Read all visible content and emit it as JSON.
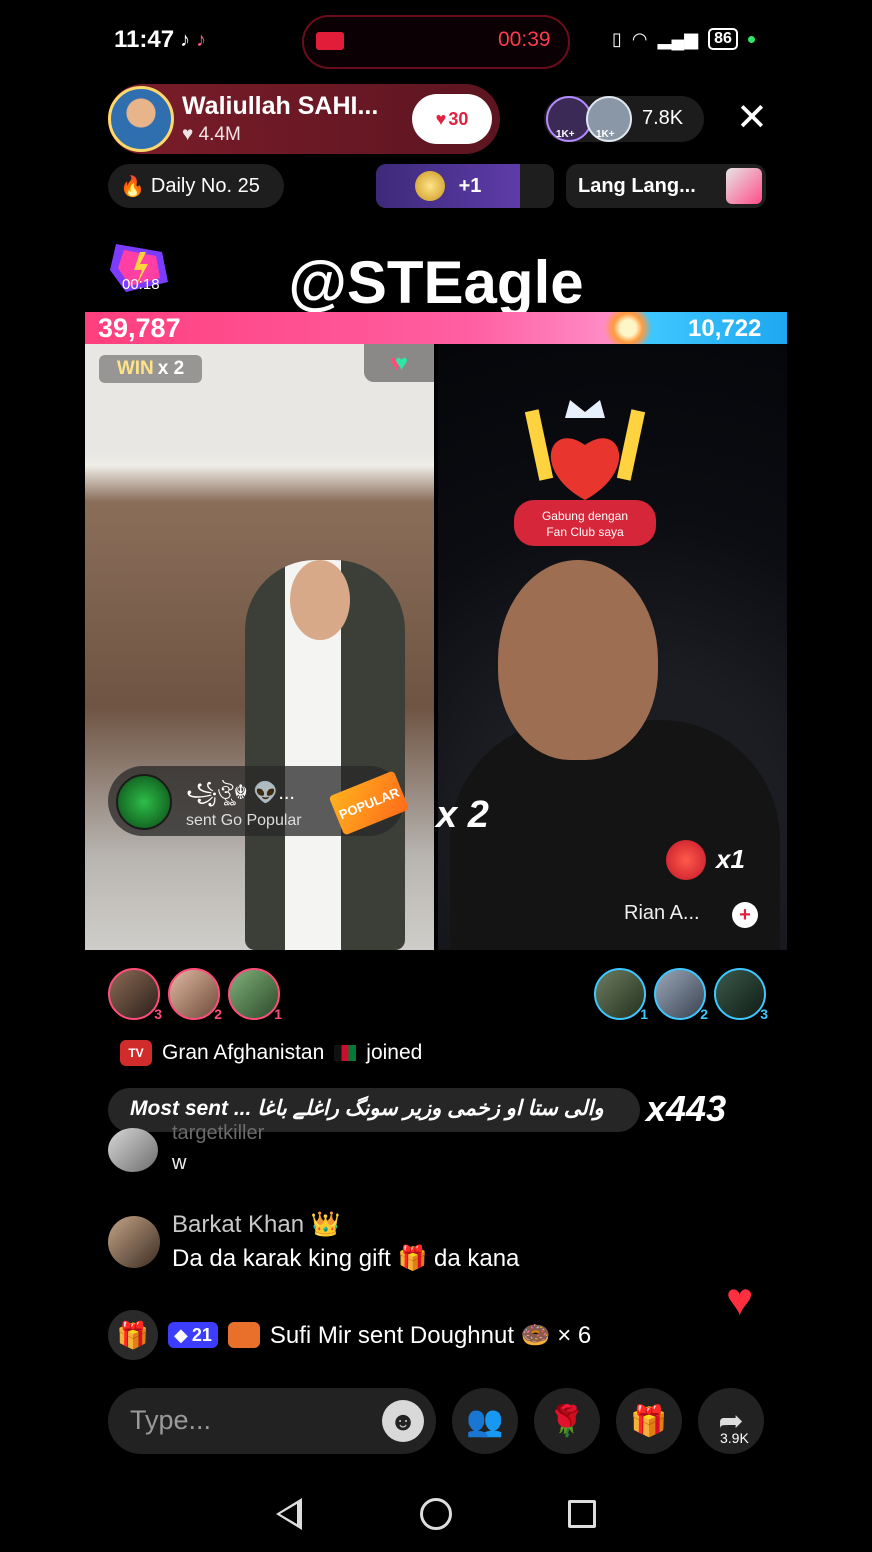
{
  "status_bar": {
    "time": "11:47",
    "record_timer": "00:39",
    "battery": "86"
  },
  "host": {
    "name": "Waliullah SAHI...",
    "likes": "4.4M",
    "fan_level": "30"
  },
  "viewers": {
    "badge_1": "1K+",
    "badge_2": "1K+",
    "count": "7.8K"
  },
  "top_row": {
    "daily_label": "Daily No. 25",
    "plus_label": "+1",
    "lang_label": "Lang Lang..."
  },
  "boost_timer": "00:18",
  "watermark": "@STEagle",
  "battle": {
    "left_score": "39,787",
    "right_score": "10,722",
    "win_label": "WIN",
    "win_multiplier": "x 2",
    "left_multiplier": "x 2",
    "right_multiplier": "x1",
    "fanclub_text": "Gabung dengan Fan Club saya",
    "right_creator": "Rian A...",
    "gift_sender_name": "꧁ঔৣ☬ 👽...",
    "gift_sent_text": "sent Go Popular",
    "popular_tag": "POPULAR"
  },
  "rankings": {
    "left": [
      "3",
      "2",
      "1"
    ],
    "right": [
      "1",
      "2",
      "3"
    ]
  },
  "chat": {
    "join_user": "Gran Afghanistan",
    "join_action": "joined",
    "tv_badge": "TV",
    "most_sent_text": "Most sent ... والی ستا او زخمی وزیر سونگ راغلے باغا",
    "most_sent_count": "x443",
    "faded_name": "targetkiller",
    "w_comment": "w",
    "barkat_name": "Barkat Khan 👑",
    "barkat_comment": "Da da karak king gift 🎁 da kana",
    "gift_diamond": "21",
    "gift_message": "Sufi Mir sent Doughnut 🍩 × 6"
  },
  "input": {
    "placeholder": "Type...",
    "share_count": "3.9K"
  },
  "icons": {
    "close": "close-icon",
    "emoji": "emoji-icon",
    "gift": "gift-icon",
    "rose": "rose-icon",
    "share": "share-icon",
    "multi_guest": "multi-guest-icon"
  },
  "colors": {
    "accent_pink": "#ff3f7d",
    "accent_blue": "#1ea7f0",
    "record_red": "#ff3b4f"
  }
}
